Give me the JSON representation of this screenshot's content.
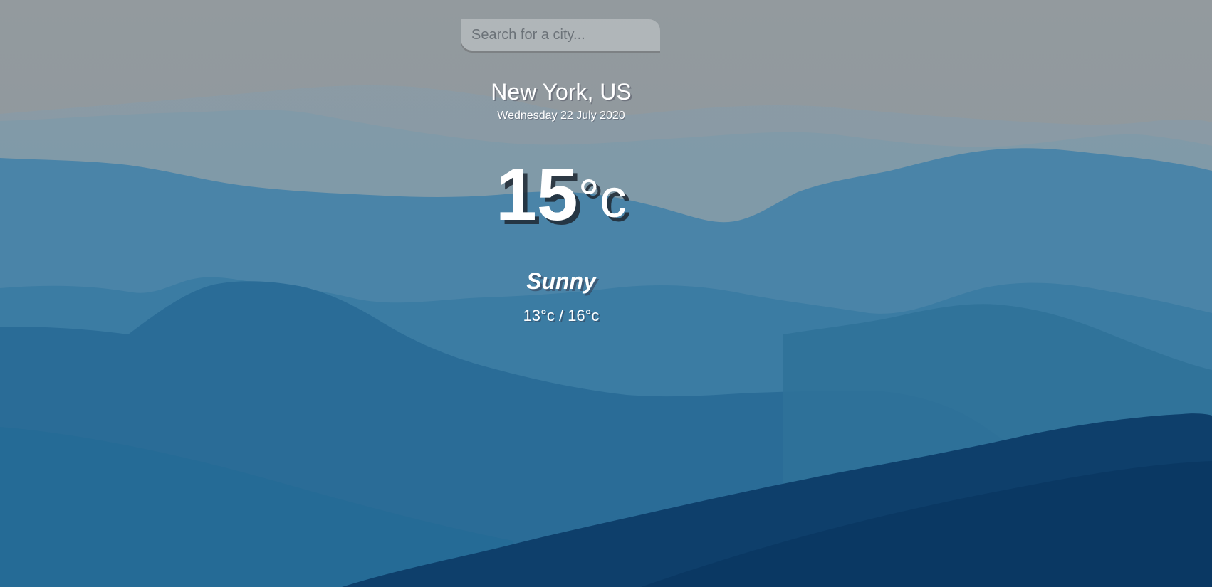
{
  "search": {
    "placeholder": "Search for a city...",
    "value": ""
  },
  "weather": {
    "location": "New York, US",
    "date": "Wednesday 22 July 2020",
    "temperature": "15",
    "unit": "°c",
    "condition": "Sunny",
    "hi_lo": "13°c / 16°c"
  },
  "colors": {
    "sky_top": "#8f979c",
    "mountain_far": "#7f9cad",
    "mountain_mid": "#3f7ea3",
    "mountain_near": "#1e6390",
    "forest_dark": "#0c3a66",
    "text": "#ffffff"
  }
}
